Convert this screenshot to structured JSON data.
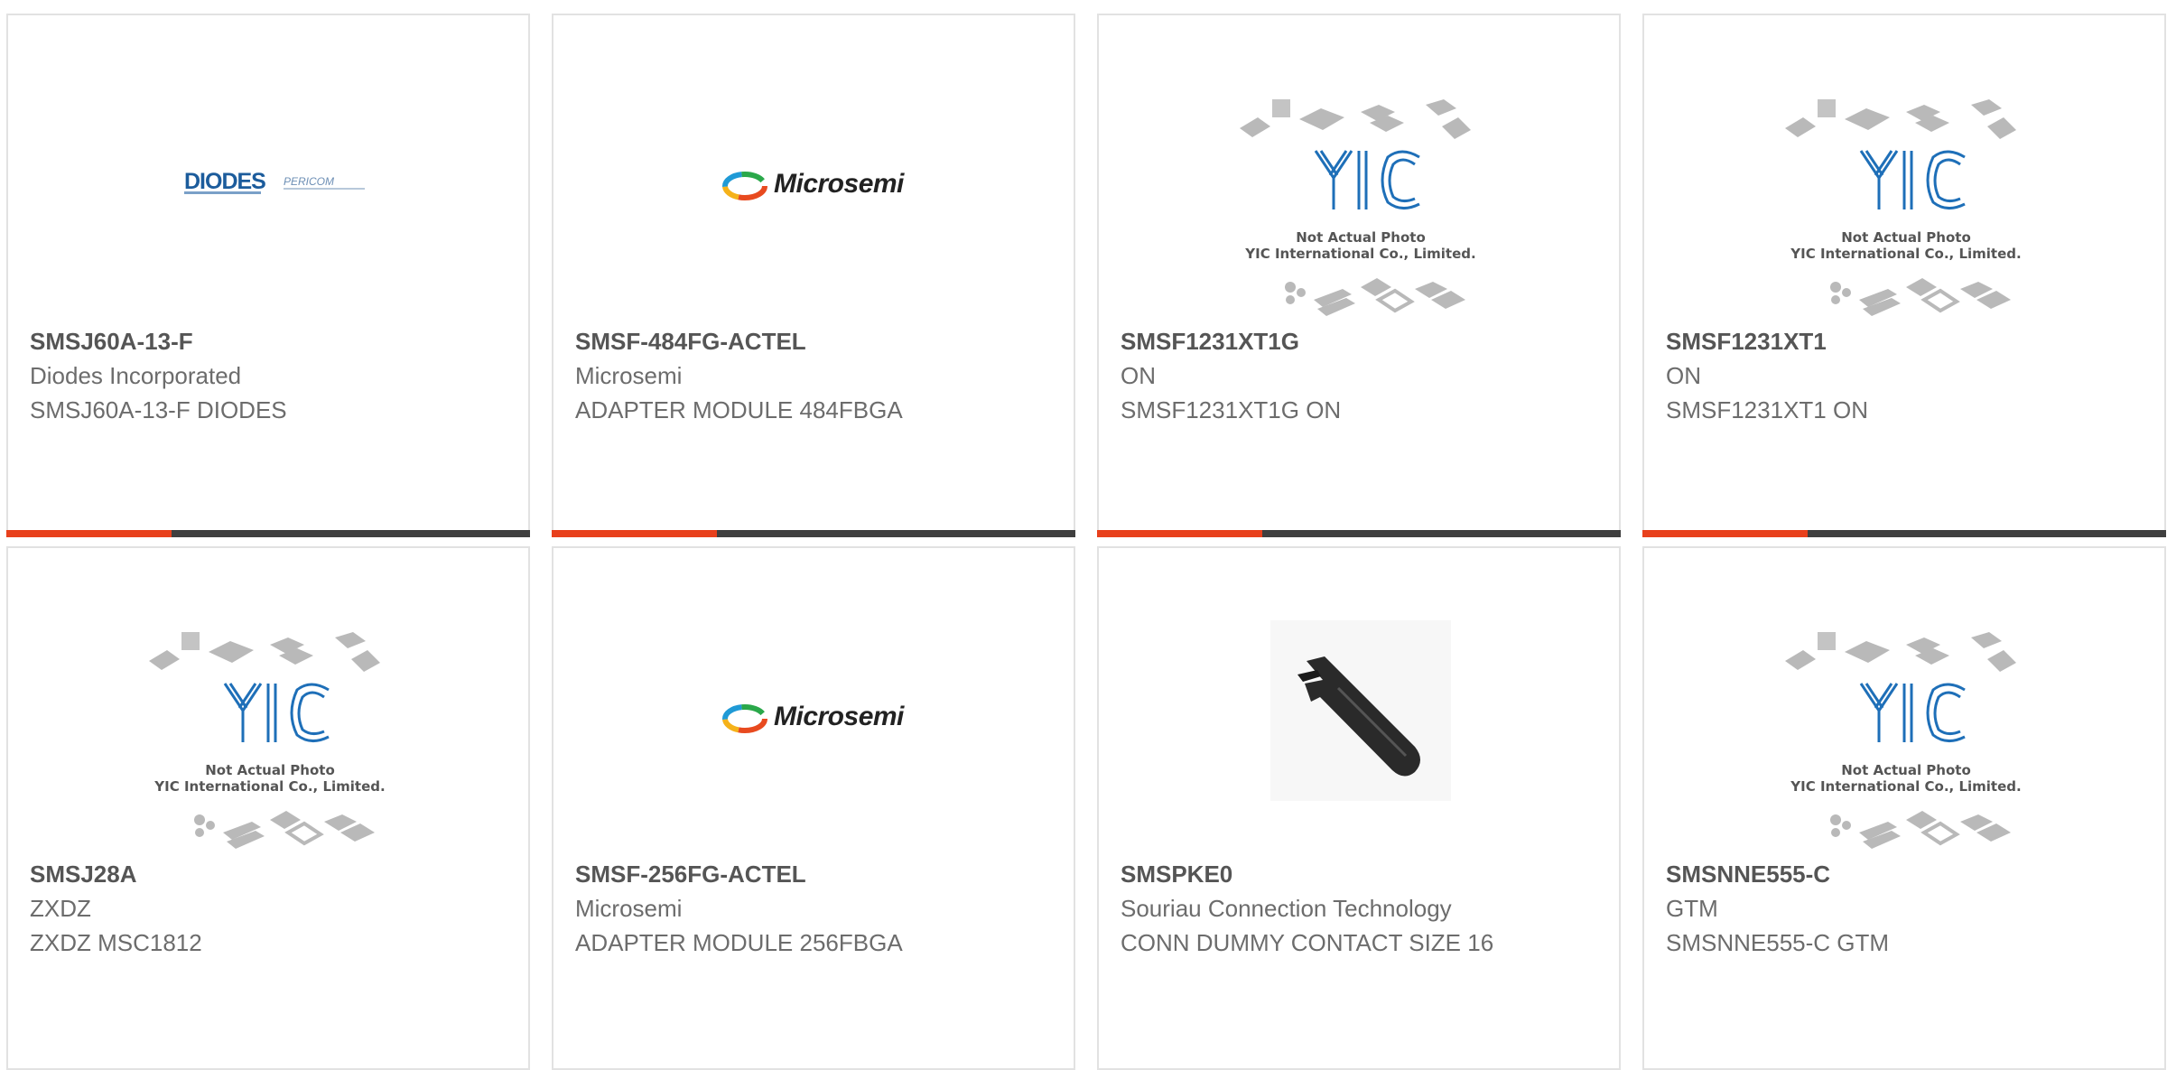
{
  "cards": [
    {
      "part": "SMSJ60A-13-F",
      "manufacturer": "Diodes Incorporated",
      "description": "SMSJ60A-13-F DIODES",
      "image": "diodes-logo"
    },
    {
      "part": "SMSF-484FG-ACTEL",
      "manufacturer": "Microsemi",
      "description": "ADAPTER MODULE 484FBGA",
      "image": "microsemi-logo"
    },
    {
      "part": "SMSF1231XT1G",
      "manufacturer": "ON",
      "description": "SMSF1231XT1G ON",
      "image": "yic-placeholder"
    },
    {
      "part": "SMSF1231XT1",
      "manufacturer": "ON",
      "description": "SMSF1231XT1 ON",
      "image": "yic-placeholder"
    },
    {
      "part": "SMSJ28A",
      "manufacturer": "ZXDZ",
      "description": "ZXDZ MSC1812",
      "image": "yic-placeholder"
    },
    {
      "part": "SMSF-256FG-ACTEL",
      "manufacturer": "Microsemi",
      "description": "ADAPTER MODULE 256FBGA",
      "image": "microsemi-logo"
    },
    {
      "part": "SMSPKE0",
      "manufacturer": "Souriau Connection Technology",
      "description": "CONN DUMMY CONTACT SIZE 16",
      "image": "connector-photo"
    },
    {
      "part": "SMSNNE555-C",
      "manufacturer": "GTM",
      "description": "SMSNNE555-C GTM",
      "image": "yic-placeholder"
    }
  ],
  "logos": {
    "diodes_main": "DIODES",
    "diodes_sub": "PERICOM",
    "microsemi": "Microsemi",
    "yic_line1": "Not Actual Photo",
    "yic_line2": "YIC International Co., Limited."
  },
  "colors": {
    "accent": "#e8401c",
    "bar": "#3f3f3f",
    "border": "#e2e2e2"
  }
}
